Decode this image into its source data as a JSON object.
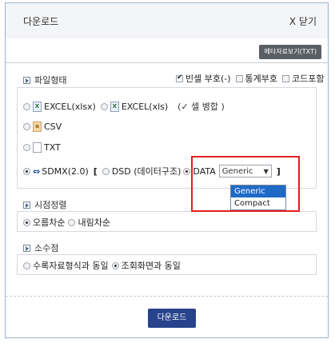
{
  "dialog": {
    "title": "다운로드",
    "close_label": "X 닫기",
    "meta_button": "메타자료보기(TXT)"
  },
  "file_format": {
    "section_title": "파일형태",
    "options": {
      "empty_cell": "빈셀 부호(-)",
      "stat_symbol": "통계부호",
      "code_include": "코드포함"
    },
    "formats": {
      "excel_xlsx": "EXCEL(xlsx)",
      "excel_xls": "EXCEL(xls)",
      "cell_merge": "(✓ 셀 병합 )",
      "csv": "CSV",
      "txt": "TXT",
      "sdmx": "SDMX(2.0)",
      "bracket_open": "[",
      "dsd": "DSD (데이터구조)",
      "data": "DATA",
      "bracket_close": "]"
    },
    "select": {
      "value": "Generic",
      "options": [
        "Generic",
        "Compact"
      ]
    }
  },
  "sort": {
    "section_title": "시점정렬",
    "ascending": "오름차순",
    "descending": "내림차순"
  },
  "decimal": {
    "section_title": "소수점",
    "source_format": "수록자료형식과 동일",
    "view_screen": "조회화면과 동일"
  },
  "download_button": "다운로드",
  "colors": {
    "primary": "#27438c",
    "highlight": "#e02020",
    "selected_option": "#1f6ac7"
  }
}
